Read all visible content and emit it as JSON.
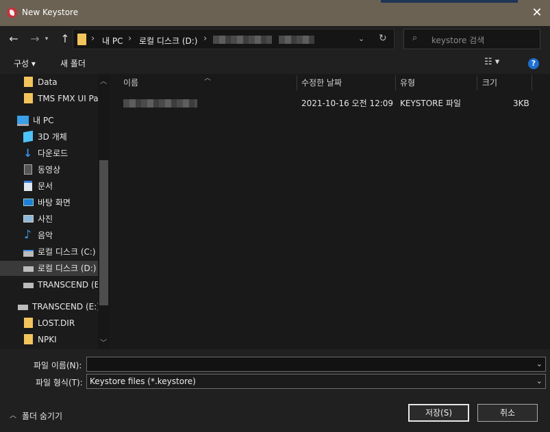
{
  "window": {
    "title": "New Keystore",
    "close": "✕"
  },
  "nav": {
    "back": "←",
    "forward": "→",
    "up": "↑",
    "breadcrumb": [
      "내 PC",
      "로컬 디스크 (D:)"
    ],
    "search_placeholder": "keystore 검색"
  },
  "toolbar": {
    "organize": "구성 ▾",
    "new_folder": "새 폴더",
    "help": "?"
  },
  "sidebar": {
    "items": [
      {
        "label": "Data",
        "icon": "folder-icon"
      },
      {
        "label": "TMS FMX UI Pac",
        "icon": "folder-icon"
      },
      {
        "label": "내 PC",
        "icon": "computer-icon"
      },
      {
        "label": "3D 개체",
        "icon": "cube-icon"
      },
      {
        "label": "다운로드",
        "icon": "download-icon"
      },
      {
        "label": "동영상",
        "icon": "video-icon"
      },
      {
        "label": "문서",
        "icon": "document-icon"
      },
      {
        "label": "바탕 화면",
        "icon": "desktop-icon"
      },
      {
        "label": "사진",
        "icon": "picture-icon"
      },
      {
        "label": "음악",
        "icon": "music-icon"
      },
      {
        "label": "로컬 디스크 (C:)",
        "icon": "drive-icon"
      },
      {
        "label": "로컬 디스크 (D:)",
        "icon": "drive-icon"
      },
      {
        "label": "TRANSCEND (E:)",
        "icon": "drive-icon"
      },
      {
        "label": "TRANSCEND (E:)",
        "icon": "drive-icon"
      },
      {
        "label": "LOST.DIR",
        "icon": "folder-icon"
      },
      {
        "label": "NPKI",
        "icon": "folder-icon"
      }
    ]
  },
  "columns": {
    "name": "이름",
    "modified": "수정한 날짜",
    "type": "유형",
    "size": "크기"
  },
  "files": [
    {
      "modified": "2021-10-16 오전 12:09",
      "type": "KEYSTORE 파일",
      "size": "3KB"
    }
  ],
  "form": {
    "filename_label": "파일 이름(N):",
    "filename_value": "",
    "filetype_label": "파일 형식(T):",
    "filetype_value": "Keystore files (*.keystore)"
  },
  "footer": {
    "hide_folders": "폴더 숨기기",
    "save": "저장(S)",
    "cancel": "취소"
  },
  "colors": {
    "titlebar": "#6b6254",
    "accent": "#1c6fd1",
    "folder": "#f2c55c"
  }
}
